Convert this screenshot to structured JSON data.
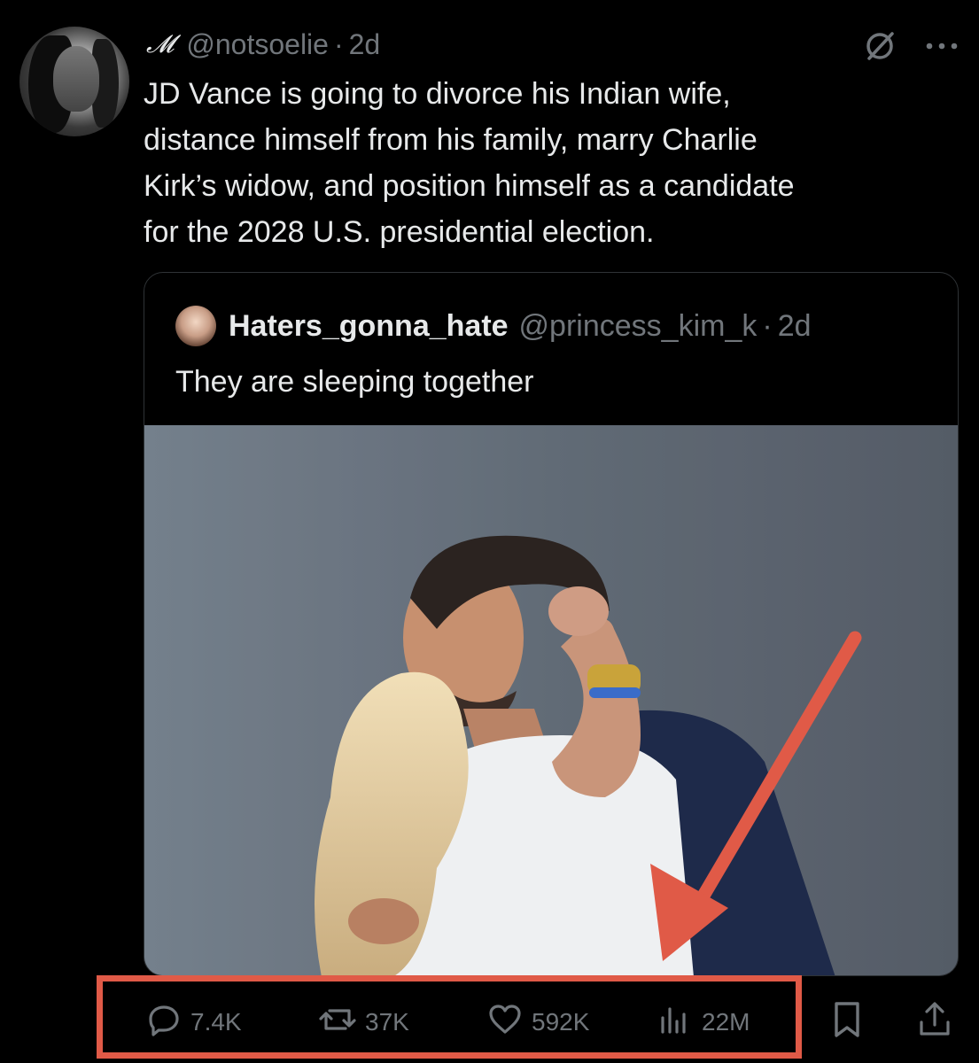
{
  "colors": {
    "background": "#000000",
    "text_primary": "#e7e9ea",
    "text_secondary": "#71767b",
    "border": "#2f3336",
    "annotation": "#e05a47"
  },
  "tweet": {
    "display_name": "𝓜",
    "handle": "@notsoelie",
    "separator": "·",
    "time": "2d",
    "text": "JD Vance is going to divorce his Indian wife,\ndistance himself from his family, marry Charlie\nKirk’s widow, and position himself as a candidate\nfor the 2028 U.S. presidential election.",
    "avatar_icon": "profile-avatar"
  },
  "top_icons": [
    "grok-slash-icon",
    "more-options-icon"
  ],
  "quote": {
    "name": "Haters_gonna_hate",
    "handle": "@princess_kim_k",
    "separator": "·",
    "time": "2d",
    "text": "They are sleeping together"
  },
  "actions": {
    "replies": "7.4K",
    "reposts": "37K",
    "likes": "592K",
    "views": "22M"
  },
  "annotation": {
    "type": "arrow-and-box",
    "color": "#e05a47"
  }
}
